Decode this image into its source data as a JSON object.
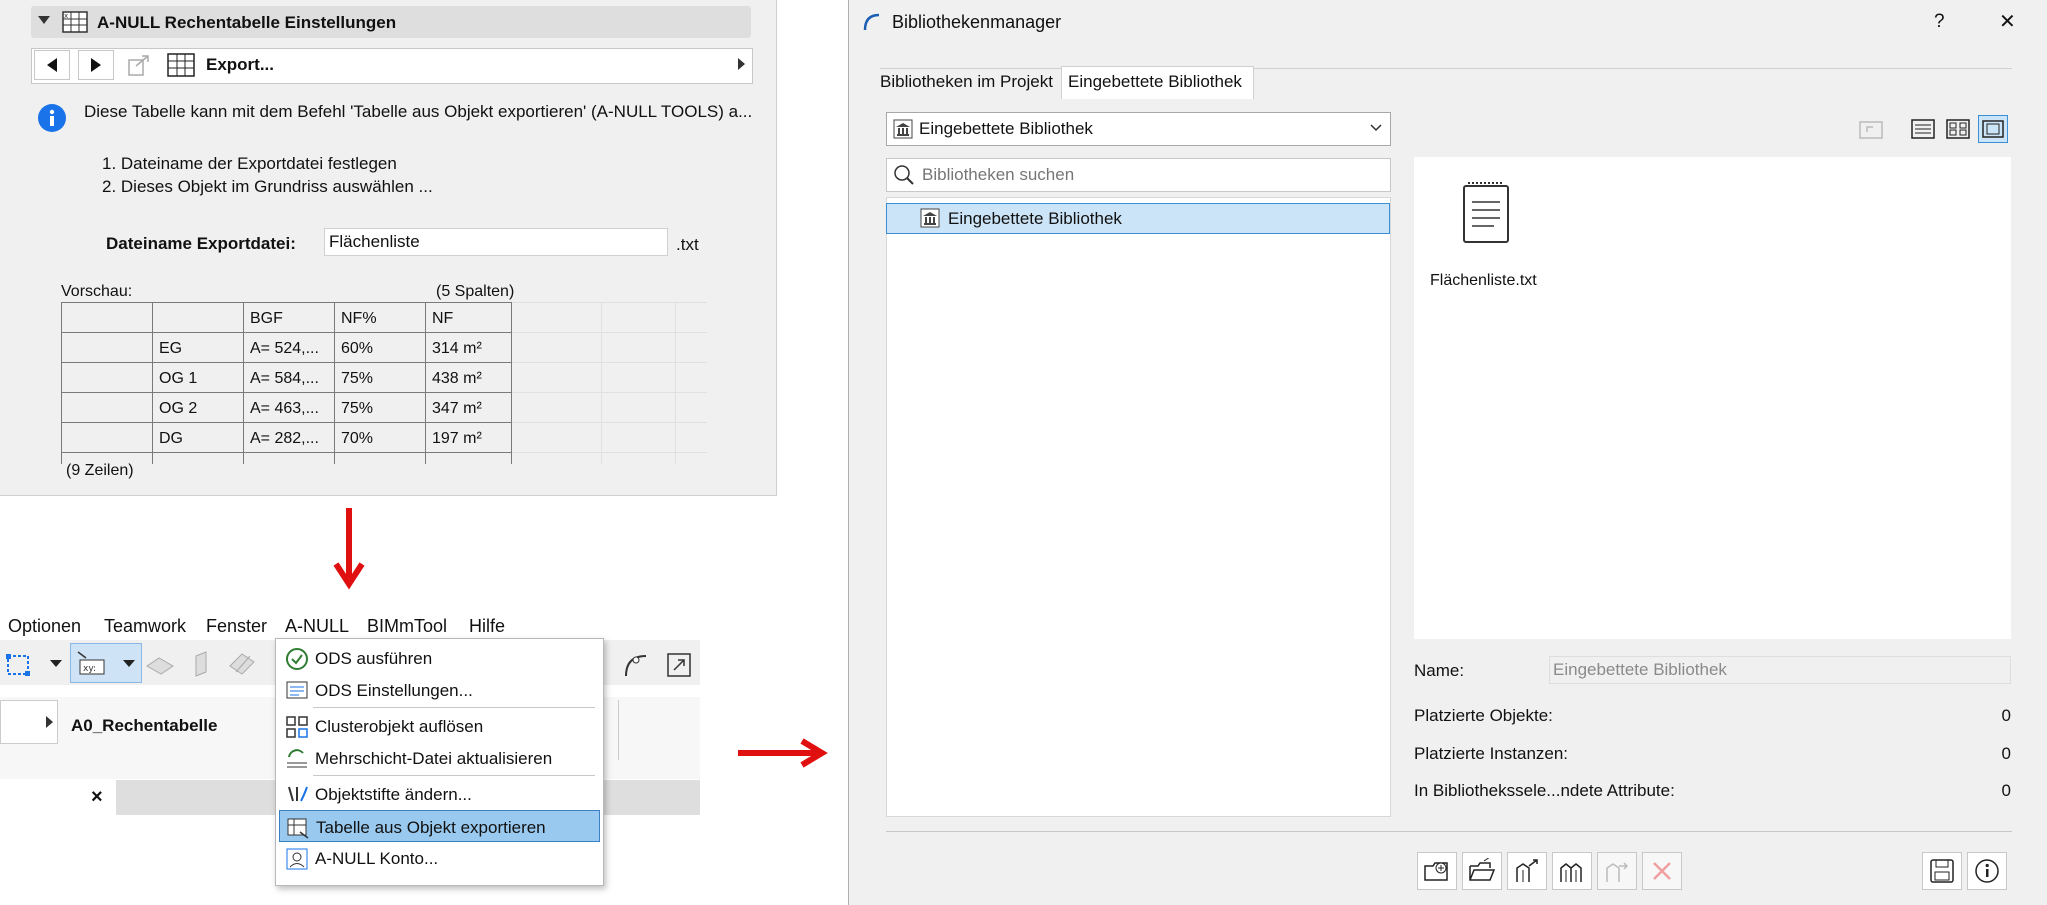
{
  "settings_panel": {
    "title": "A-NULL Rechentabelle Einstellungen",
    "export_label": "Export...",
    "info_text": "Diese Tabelle kann mit dem Befehl 'Tabelle aus Objekt exportieren' (A-NULL TOOLS) a...",
    "step1": "1. Dateiname der Exportdatei festlegen",
    "step2": "2. Dieses Objekt im Grundriss auswählen ...",
    "filename_label": "Dateiname Exportdatei:",
    "filename_value": "Flächenliste",
    "filename_ext": ".txt",
    "preview_label": "Vorschau:",
    "columns_note": "(5 Spalten)",
    "rows_note": "(9 Zeilen)",
    "table": {
      "header": [
        "",
        "",
        "BGF",
        "NF%",
        "NF"
      ],
      "rows": [
        [
          "",
          "EG",
          "A= 524,...",
          "60%",
          "314 m²"
        ],
        [
          "",
          "OG 1",
          "A= 584,...",
          "75%",
          "438 m²"
        ],
        [
          "",
          "OG 2",
          "A= 463,...",
          "75%",
          "347 m²"
        ],
        [
          "",
          "DG",
          "A= 282,...",
          "70%",
          "197 m²"
        ]
      ]
    }
  },
  "menubar": {
    "items": [
      "Optionen",
      "Teamwork",
      "Fenster",
      "A-NULL",
      "BIMmTool",
      "Hilfe"
    ]
  },
  "info_box": {
    "layer_name": "A0_Rechentabelle",
    "close_glyph": "×"
  },
  "dropdown": {
    "items": [
      {
        "label": "ODS ausführen",
        "icon": "ods-run-icon"
      },
      {
        "label": "ODS Einstellungen...",
        "icon": "ods-settings-icon"
      },
      {
        "label": "Clusterobjekt auflösen",
        "icon": "cluster-icon"
      },
      {
        "label": "Mehrschicht-Datei aktualisieren",
        "icon": "refresh-layers-icon"
      },
      {
        "label": "Objektstifte ändern...",
        "icon": "pens-icon"
      },
      {
        "label": "Tabelle aus Objekt exportieren",
        "icon": "table-export-icon",
        "highlighted": true
      },
      {
        "label": "A-NULL Konto...",
        "icon": "account-icon"
      }
    ]
  },
  "dialog": {
    "title": "Bibliothekenmanager",
    "help": "?",
    "close": "✕",
    "tabs": [
      "Bibliotheken im Projekt",
      "Eingebettete Bibliothek"
    ],
    "active_tab": 1,
    "library_select": "Eingebettete Bibliothek",
    "search_placeholder": "Bibliotheken suchen",
    "tree_items": [
      "Eingebettete Bibliothek"
    ],
    "file_name": "Flächenliste.txt",
    "properties": {
      "name_label": "Name:",
      "name_value": "Eingebettete Bibliothek",
      "placed_objects_label": "Platzierte Objekte:",
      "placed_objects_value": "0",
      "placed_instances_label": "Platzierte Instanzen:",
      "placed_instances_value": "0",
      "attributes_label": "In Bibliothekssele...ndete Attribute:",
      "attributes_value": "0"
    }
  },
  "colors": {
    "accent_blue": "#0078d4",
    "highlight": "#99c9ef",
    "selection": "#cce4f7",
    "arrow_red": "#e01010"
  }
}
